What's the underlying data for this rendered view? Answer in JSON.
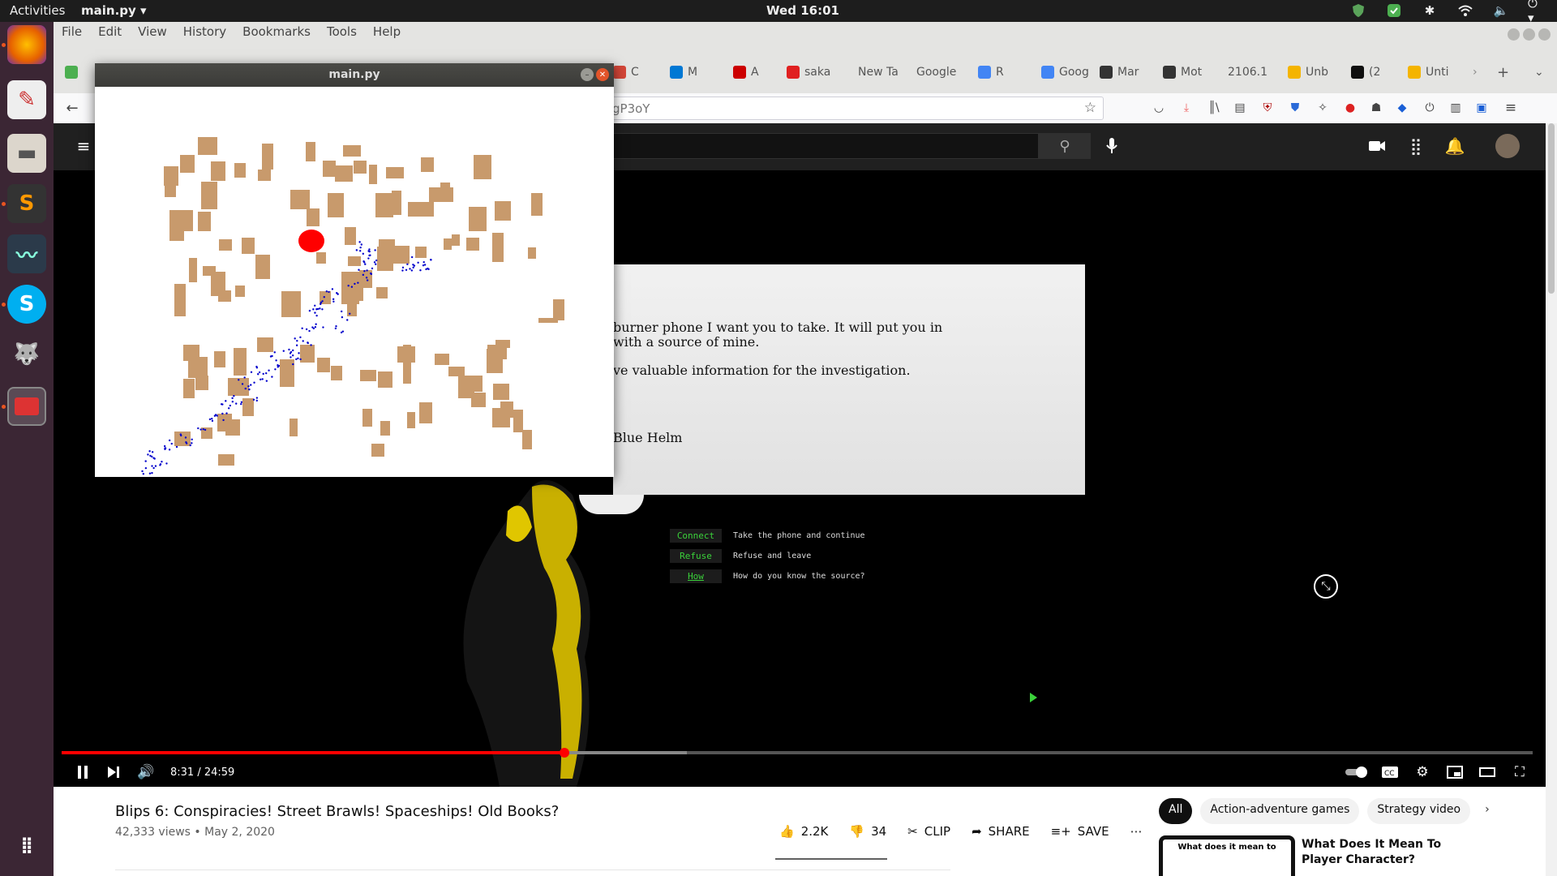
{
  "topbar": {
    "activities": "Activities",
    "app_name": "main.py ▾",
    "clock": "Wed 16:01"
  },
  "firefox": {
    "menu": [
      "File",
      "Edit",
      "View",
      "History",
      "Bookmarks",
      "Tools",
      "Help"
    ],
    "tabs": [
      {
        "label": "C",
        "color": "#d44638"
      },
      {
        "label": "M",
        "color": "#0078d4"
      },
      {
        "label": "A",
        "color": "#cc0000"
      },
      {
        "label": "saka",
        "color": "#e02020"
      },
      {
        "label": "New Ta",
        "color": ""
      },
      {
        "label": "Google",
        "color": ""
      },
      {
        "label": "R",
        "color": "#4285f4"
      },
      {
        "label": "Goog",
        "color": "#4285f4"
      },
      {
        "label": "Mar",
        "color": "#333333"
      },
      {
        "label": "Mot",
        "color": "#333333"
      },
      {
        "label": "2106.1",
        "color": ""
      },
      {
        "label": "Unb",
        "color": "#f4b400"
      },
      {
        "label": "(2",
        "color": "#0f0f0f"
      },
      {
        "label": "Unti",
        "color": "#f4b400"
      }
    ],
    "url": "gP3oY",
    "bookmark_icon": "star-icon"
  },
  "video": {
    "letter_lines": [
      "burner phone I want you to take. It will put you in",
      "with a source of mine.",
      "ve valuable information for the investigation.",
      "Blue Helm"
    ],
    "choices": [
      {
        "button": "Connect",
        "text": "Take the phone and continue"
      },
      {
        "button": "Refuse",
        "text": "Refuse and leave"
      },
      {
        "button": "How",
        "text": "How do you know the source?"
      }
    ],
    "time": "8:31 / 24:59",
    "progress_played": 0.342,
    "progress_loaded": 0.425
  },
  "yt": {
    "title": "Blips 6: Conspiracies! Street Brawls! Spaceships! Old Books?",
    "meta": "42,333 views • May 2, 2020",
    "likes": "2.2K",
    "dislikes": "34",
    "clip": "CLIP",
    "share": "SHARE",
    "save": "SAVE",
    "chips": [
      "All",
      "Action-adventure games",
      "Strategy video"
    ],
    "rec_title": "What Does It Mean To Player Character?",
    "rec_thumb_text": "What does it mean to"
  },
  "pywin": {
    "title": "main.py",
    "obstacle_color": "#c89a6c",
    "agent_color": "#ff0000",
    "particle_color": "#0000cc"
  }
}
